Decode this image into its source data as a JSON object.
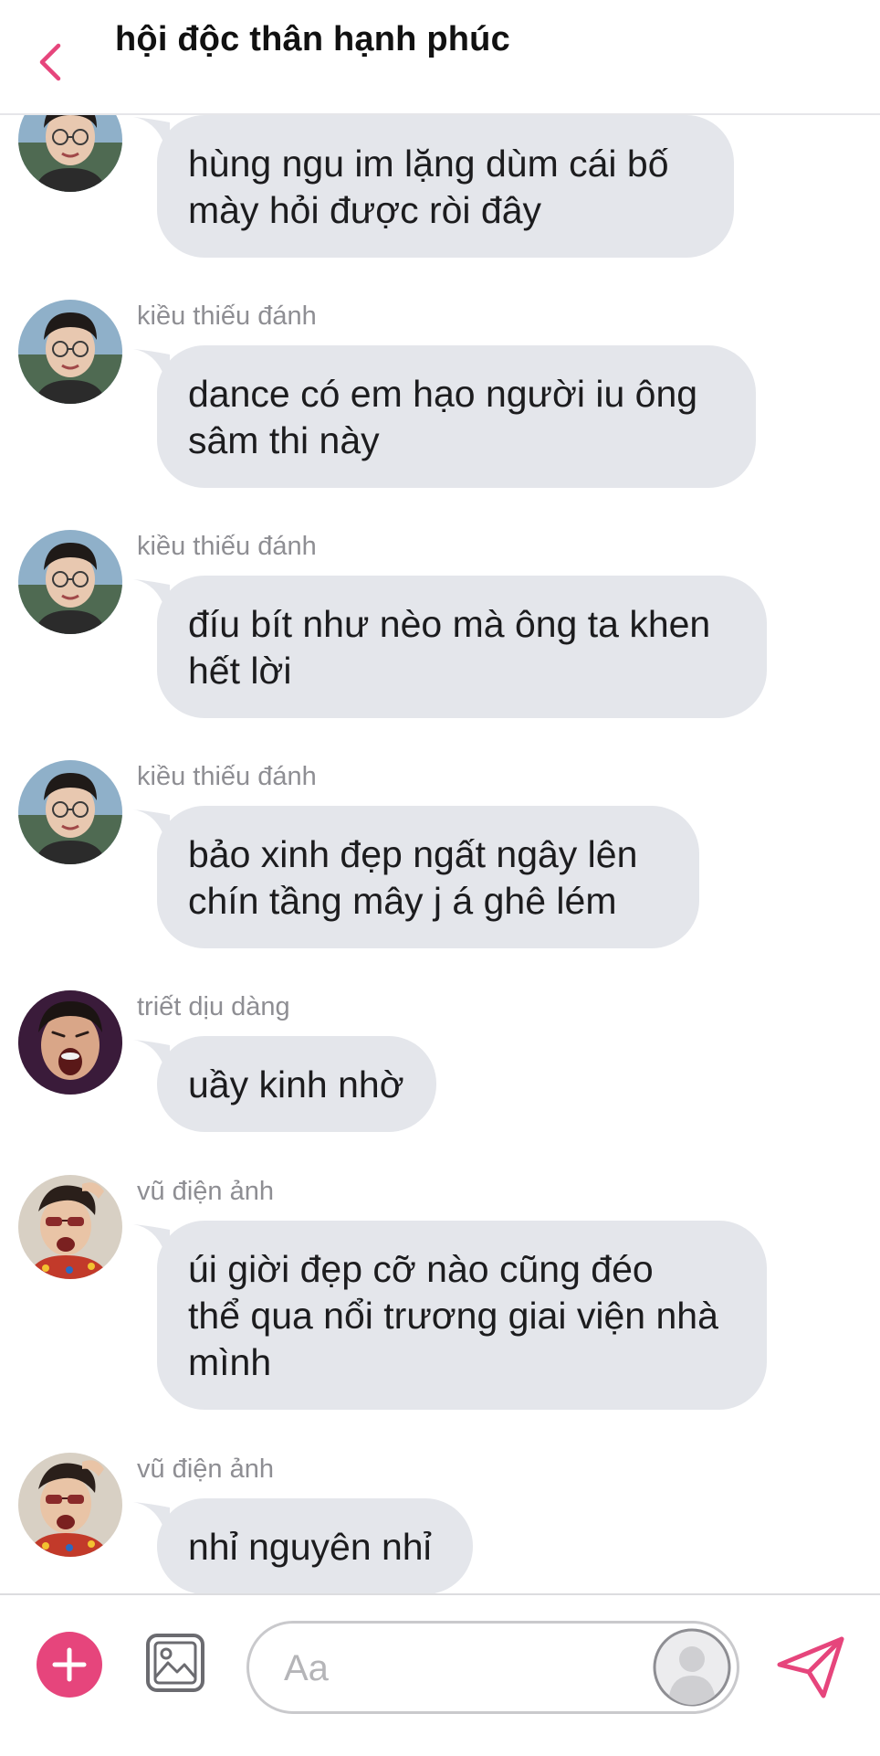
{
  "header": {
    "title": "hội độc thân hạnh phúc",
    "back_icon": "chevron-left-icon"
  },
  "colors": {
    "accent": "#e6457c",
    "bubble_background": "#e4e6eb",
    "sender_text": "#8e8e93",
    "message_text": "#1c1c1e"
  },
  "messages": [
    {
      "sender": "",
      "text_lines": [
        "hùng ngu im lặng dùm cái bố",
        "mày hỏi được ròi đây"
      ],
      "avatar": "avatar-glasses-boy"
    },
    {
      "sender": "kiều thiếu đánh",
      "text_lines": [
        "dance có em hạo người iu ông",
        "sâm thi này"
      ],
      "avatar": "avatar-glasses-boy"
    },
    {
      "sender": "kiều thiếu đánh",
      "text_lines": [
        "đíu bít như nèo mà ông ta khen",
        "hết lời"
      ],
      "avatar": "avatar-glasses-boy"
    },
    {
      "sender": "kiều thiếu đánh",
      "text_lines": [
        "bảo xinh đẹp ngất ngây lên",
        "chín tầng mây j á ghê lém"
      ],
      "avatar": "avatar-glasses-boy"
    },
    {
      "sender": "triết dịu dàng",
      "text_lines": [
        "uầy kinh nhờ"
      ],
      "avatar": "avatar-shouting-boy"
    },
    {
      "sender": "vũ điện ảnh",
      "text_lines": [
        "úi giời đẹp cỡ nào cũng đéo",
        "thể qua nổi trương giai viện nhà",
        "mình"
      ],
      "avatar": "avatar-sunglasses-boy"
    },
    {
      "sender": "vũ điện ảnh",
      "text_lines": [
        "nhỉ nguyên nhỉ"
      ],
      "avatar": "avatar-sunglasses-boy"
    }
  ],
  "composer": {
    "placeholder": "Aa",
    "value": "",
    "icons": {
      "add": "plus-icon",
      "image": "image-icon",
      "profile": "user-placeholder-icon",
      "send": "send-icon"
    }
  }
}
